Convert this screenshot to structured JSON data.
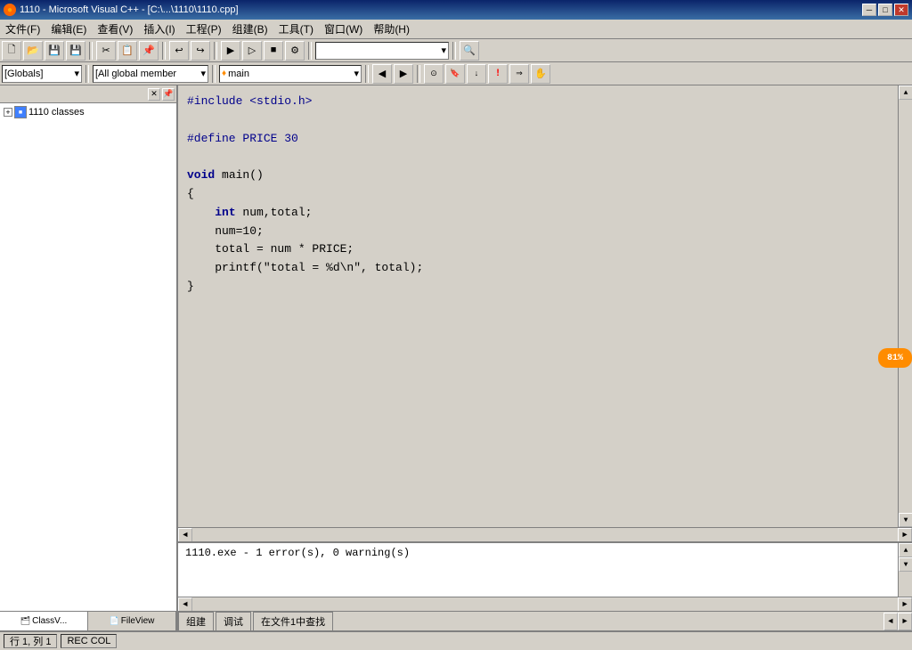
{
  "title_bar": {
    "title": "1110 - Microsoft Visual C++ - [C:\\...\\1110\\1110.cpp]",
    "icon": "●",
    "btn_minimize": "─",
    "btn_restore": "□",
    "btn_close": "✕",
    "inner_restore": "◱",
    "inner_close": "✕"
  },
  "menu": {
    "items": [
      {
        "label": "文件(F)"
      },
      {
        "label": "编辑(E)"
      },
      {
        "label": "查看(V)"
      },
      {
        "label": "插入(I)"
      },
      {
        "label": "工程(P)"
      },
      {
        "label": "组建(B)"
      },
      {
        "label": "工具(T)"
      },
      {
        "label": "窗口(W)"
      },
      {
        "label": "帮助(H)"
      }
    ]
  },
  "toolbar1": {
    "search_placeholder": "",
    "search_value": ""
  },
  "toolbar2": {
    "globals_label": "[Globals]",
    "members_label": "[All global member",
    "main_label": "♦ main"
  },
  "sidebar": {
    "tree_items": [
      {
        "label": "1110 classes",
        "icon": "📁",
        "expand": "+"
      }
    ],
    "tabs": [
      {
        "label": "ClassV...",
        "icon": "🗂",
        "active": true
      },
      {
        "label": "FileView",
        "icon": "📄",
        "active": false
      }
    ]
  },
  "code": {
    "lines": [
      {
        "type": "preprocessor",
        "text": "#include <stdio.h>"
      },
      {
        "type": "blank",
        "text": ""
      },
      {
        "type": "preprocessor",
        "text": "#define PRICE 30"
      },
      {
        "type": "blank",
        "text": ""
      },
      {
        "type": "mixed",
        "parts": [
          {
            "type": "keyword",
            "text": "void"
          },
          {
            "type": "normal",
            "text": " main()"
          }
        ]
      },
      {
        "type": "normal",
        "text": "{"
      },
      {
        "type": "indented",
        "parts": [
          {
            "type": "keyword",
            "text": "    int"
          },
          {
            "type": "normal",
            "text": " num,total;"
          }
        ]
      },
      {
        "type": "normal",
        "text": "    num=10;"
      },
      {
        "type": "normal",
        "text": "    total = num * PRICE;"
      },
      {
        "type": "normal",
        "text": "    printf(\"total = %d\\n\", total);"
      },
      {
        "type": "normal",
        "text": "}"
      }
    ]
  },
  "output": {
    "text": "1110.exe - 1 error(s), 0 warning(s)",
    "tabs": [
      {
        "label": "组建",
        "active": false
      },
      {
        "label": "调试",
        "active": false
      },
      {
        "label": "在文件1中查找",
        "active": false
      }
    ]
  },
  "status_bar": {
    "line_col": "行 1, 列 1",
    "info": "REC COL"
  },
  "orange_badge": {
    "text": "81%"
  }
}
